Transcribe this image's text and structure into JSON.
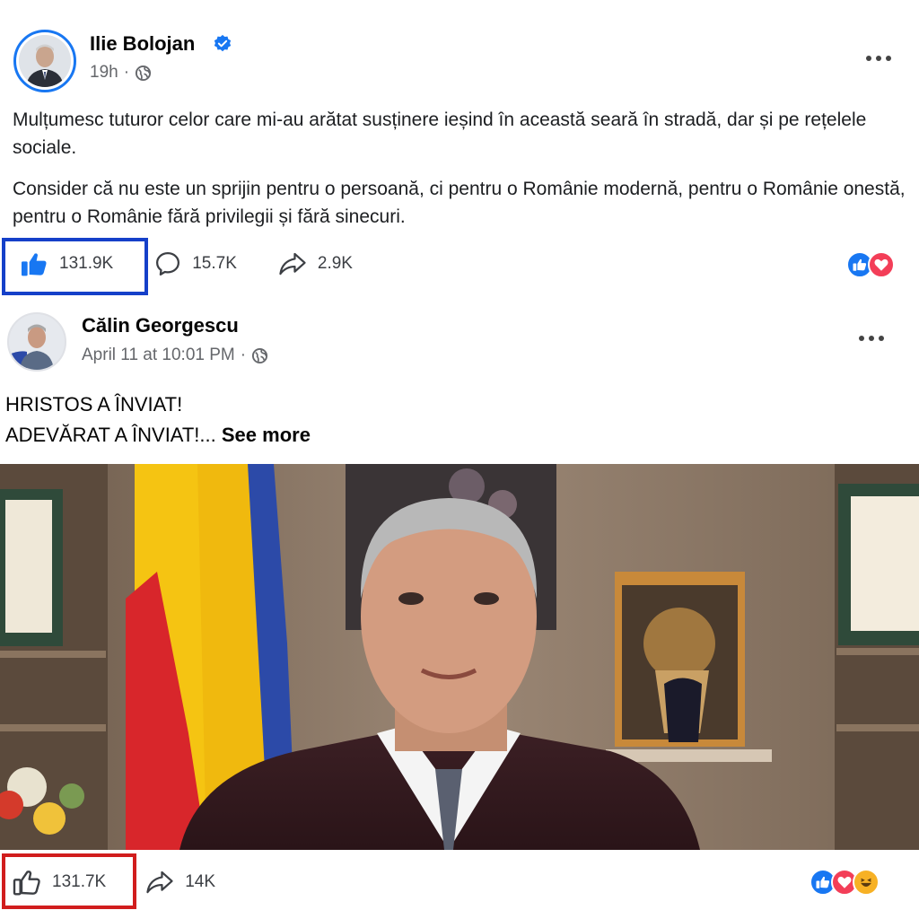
{
  "post1": {
    "author": "Ilie Bolojan",
    "time": "19h",
    "separator": "·",
    "paragraphs": [
      "Mulțumesc tuturor celor care mi-au arătat susținere ieșind în această seară în stradă, dar și pe rețelele sociale.",
      "Consider că nu este un sprijin pentru o persoană, ci pentru o Românie modernă, pentru o Românie onestă, pentru o Românie fără privilegii și fără sinecuri."
    ],
    "likes": "131.9K",
    "comments": "15.7K",
    "shares": "2.9K",
    "reactions": [
      "like",
      "love"
    ]
  },
  "post2": {
    "author": "Călin Georgescu",
    "time": "April 11 at 10:01 PM",
    "separator": "·",
    "line1": "HRISTOS A ÎNVIAT!",
    "line2": "ADEVĂRAT A ÎNVIAT!...",
    "see_more": "See more",
    "likes": "131.7K",
    "shares": "14K",
    "reactions": [
      "like",
      "love",
      "haha"
    ]
  },
  "colors": {
    "facebook_blue": "#1877f2",
    "highlight_blue": "#1540c9",
    "highlight_red": "#d11d1d",
    "flag_blue": "#2c4aa8",
    "flag_yellow": "#f5c412",
    "flag_red": "#d8262b"
  }
}
